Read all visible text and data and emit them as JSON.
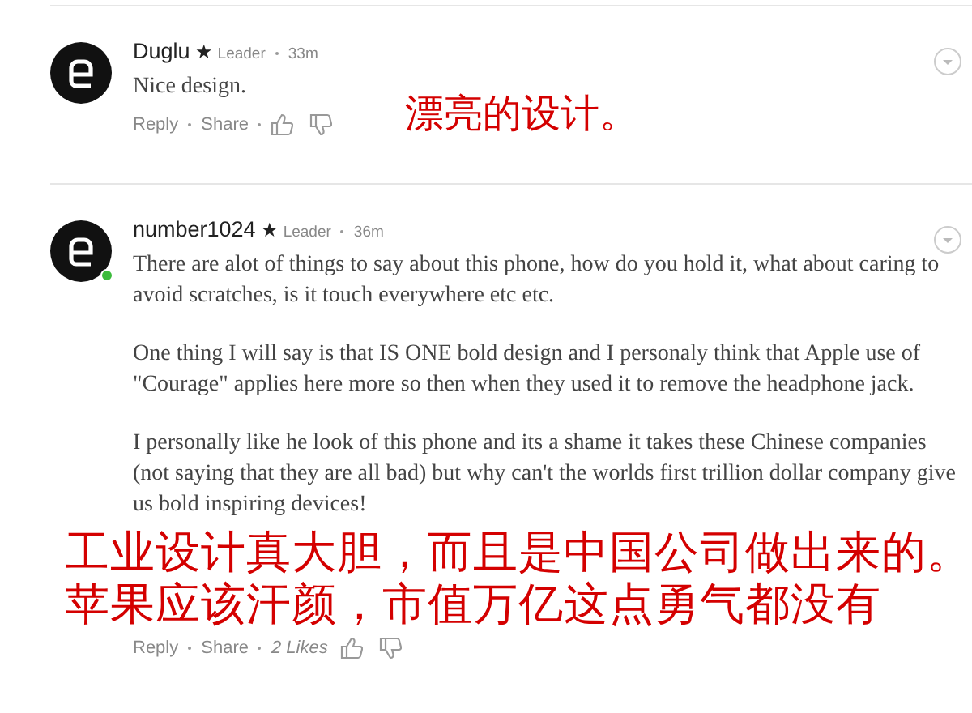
{
  "comments": [
    {
      "author": "Duglu",
      "star": "★",
      "badge": "Leader",
      "time": "33m",
      "paragraphs": [
        "Nice design."
      ],
      "actions": [
        "Reply",
        "Share"
      ]
    },
    {
      "author": "number1024",
      "star": "★",
      "badge": "Leader",
      "time": "36m",
      "online": true,
      "paragraphs": [
        "There are alot of things to say about this phone, how do you hold it, what about caring to avoid scratches, is it touch everywhere etc etc.",
        "One thing I will say is that IS ONE bold design and I personaly think that Apple use of \"Courage\" applies here more so then when they used it to remove the headphone jack.",
        "I personally like he look of this phone and its a shame it takes these Chinese companies (not saying that they are all bad) but why can't the worlds first trillion dollar company give us bold inspiring devices!"
      ],
      "annotation": [
        "工业设计真大胆，而且是中国公司做出来的。",
        "苹果应该汗颜，市值万亿这点勇气都没有"
      ],
      "actions": [
        "Reply",
        "Share"
      ],
      "likes": "2 Likes"
    }
  ],
  "annotations": [
    {
      "kind": "small",
      "lines": [
        "漂亮的设计。"
      ]
    }
  ]
}
